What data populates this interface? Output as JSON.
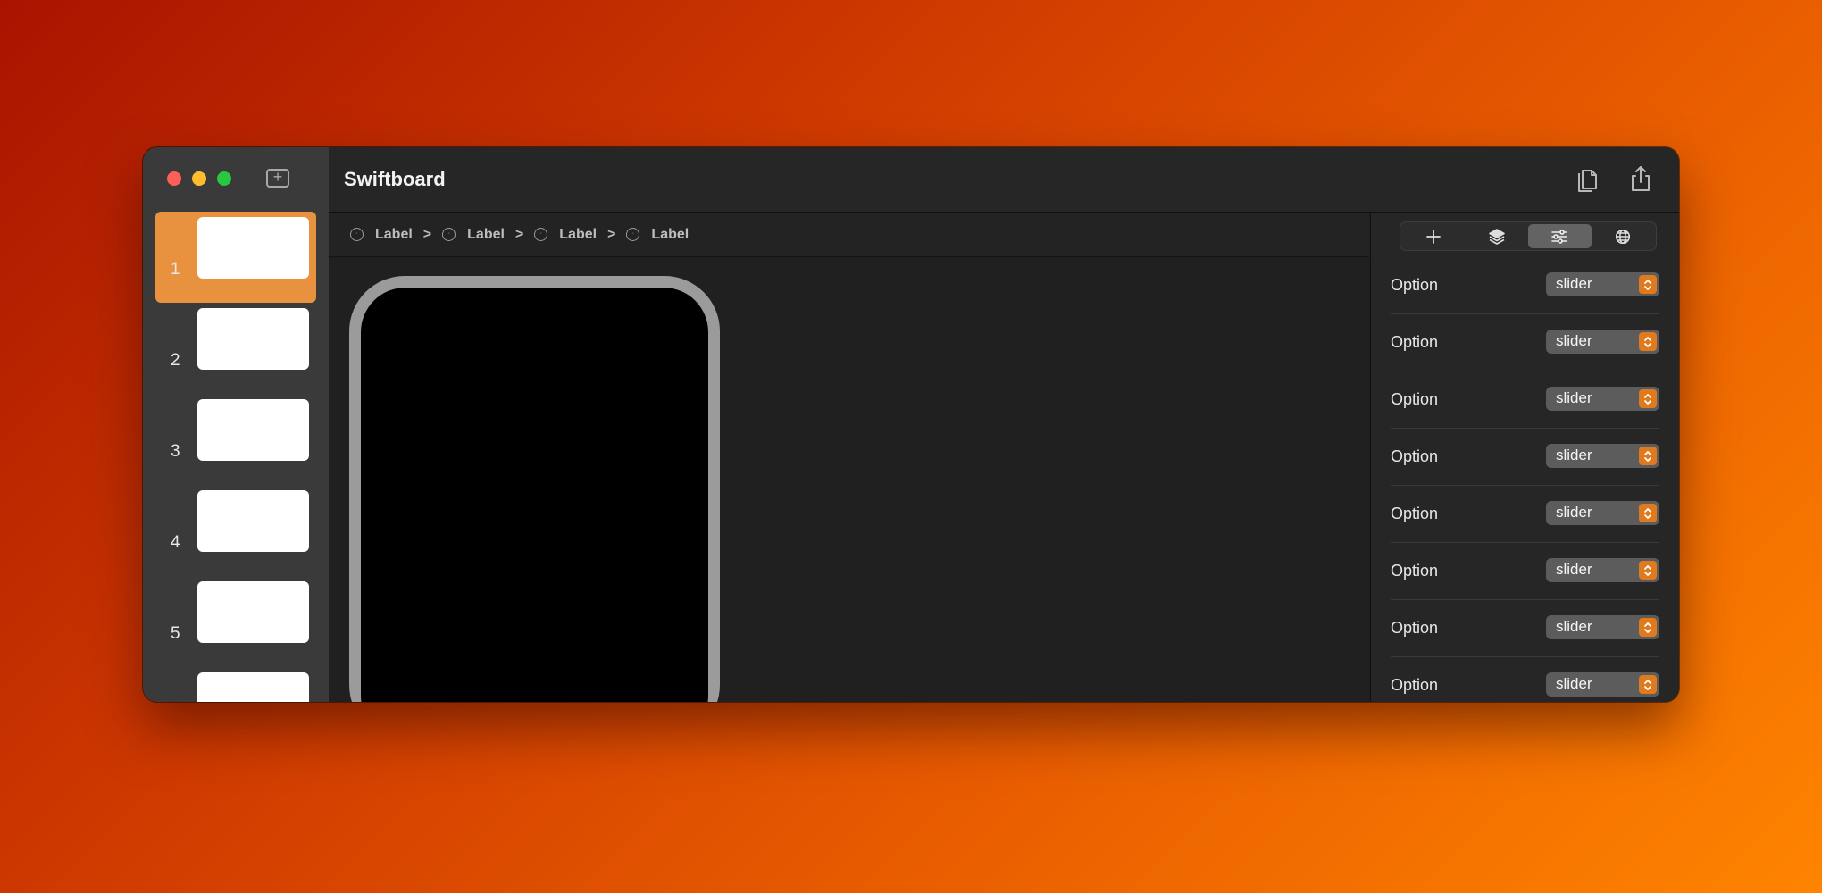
{
  "window": {
    "title": "Swiftboard"
  },
  "sidebar": {
    "new_slide_icon": "plus-square-icon",
    "slides": [
      {
        "number": "1",
        "selected": true
      },
      {
        "number": "2",
        "selected": false
      },
      {
        "number": "3",
        "selected": false
      },
      {
        "number": "4",
        "selected": false
      },
      {
        "number": "5",
        "selected": false
      },
      {
        "number": "",
        "selected": false
      }
    ]
  },
  "toolbar": {
    "duplicate_icon": "duplicate-icon",
    "share_icon": "share-icon"
  },
  "breadcrumb": {
    "items": [
      {
        "label": "Label",
        "icon": "component-icon"
      },
      {
        "label": "Label",
        "icon": "component-icon"
      },
      {
        "label": "Label",
        "icon": "component-icon"
      },
      {
        "label": "Label",
        "icon": "component-icon"
      }
    ],
    "separator": ">"
  },
  "inspector": {
    "tabs": [
      {
        "icon": "plus-icon",
        "active": false
      },
      {
        "icon": "layers-icon",
        "active": false
      },
      {
        "icon": "sliders-icon",
        "active": true
      },
      {
        "icon": "globe-icon",
        "active": false
      }
    ],
    "rows": [
      {
        "label": "Option",
        "value": "slider"
      },
      {
        "label": "Option",
        "value": "slider"
      },
      {
        "label": "Option",
        "value": "slider"
      },
      {
        "label": "Option",
        "value": "slider"
      },
      {
        "label": "Option",
        "value": "slider"
      },
      {
        "label": "Option",
        "value": "slider"
      },
      {
        "label": "Option",
        "value": "slider"
      },
      {
        "label": "Option",
        "value": "slider"
      }
    ]
  },
  "colors": {
    "accent": "#e8913f",
    "select_arrow": "#e07a1f",
    "background_gradient_start": "#a81400",
    "background_gradient_end": "#ff8400"
  }
}
